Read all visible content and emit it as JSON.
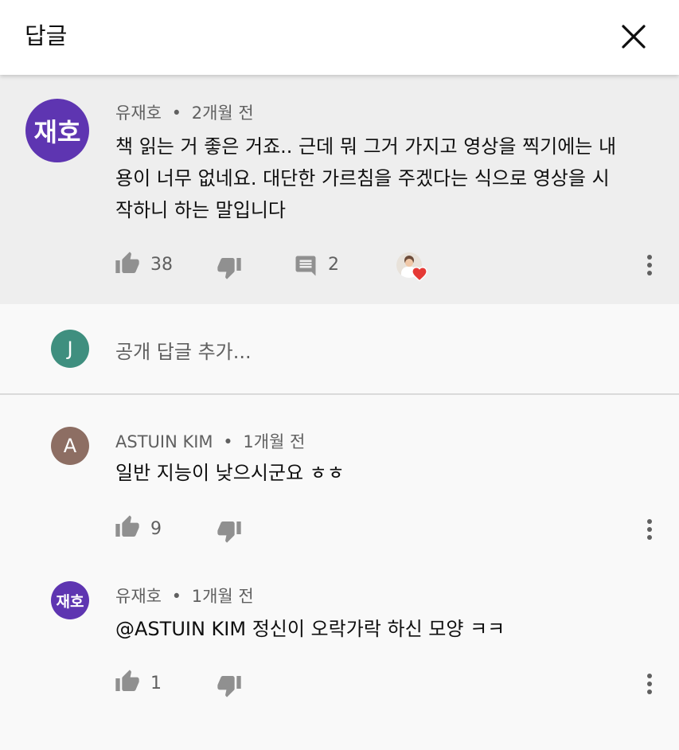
{
  "header": {
    "title": "답글"
  },
  "parent_comment": {
    "avatar_text": "재호",
    "avatar_color": "#5e35b1",
    "author": "유재호",
    "separator": "•",
    "time": "2개월 전",
    "text_lines": [
      "책 읽는 거 좋은 거죠.. 근데 뭐 그거 가지고 영상을 찍기에는 내",
      "용이 너무 없네요. 대단한 가르침을 주겠다는 식으로 영상을 시",
      "작하니 하는 말입니다"
    ],
    "likes": "38",
    "replies": "2",
    "creator_heart": true
  },
  "add_reply": {
    "avatar_text": "J",
    "avatar_color": "#3f8f7f",
    "placeholder": "공개 답글 추가..."
  },
  "replies": [
    {
      "avatar_text": "A",
      "avatar_color": "#8d6e63",
      "author": "ASTUIN KIM",
      "separator": "•",
      "time": "1개월 전",
      "text": "일반 지능이 낮으시군요 ㅎㅎ",
      "likes": "9"
    },
    {
      "avatar_text": "재호",
      "avatar_color": "#5e35b1",
      "author": "유재호",
      "separator": "•",
      "time": "1개월 전",
      "text": "@ASTUIN KIM 정신이 오락가락 하신 모양 ㅋㅋ",
      "likes": "1"
    }
  ],
  "icons": {
    "close": "close-icon",
    "like": "thumb-up-icon",
    "dislike": "thumb-down-icon",
    "reply": "comment-icon",
    "more": "more-vert-icon",
    "heart": "creator-heart-icon"
  }
}
